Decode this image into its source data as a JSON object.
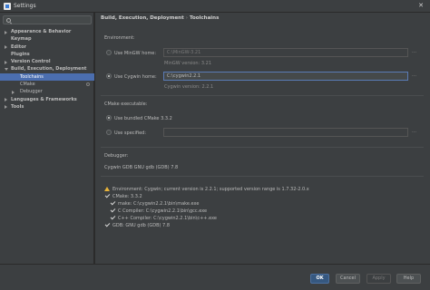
{
  "window": {
    "title": "Settings"
  },
  "search": {
    "placeholder": ""
  },
  "sidebar": {
    "items": [
      {
        "label": "Appearance & Behavior",
        "level": 0,
        "arrow": "right",
        "bold": true
      },
      {
        "label": "Keymap",
        "level": 0,
        "arrow": "none",
        "bold": true
      },
      {
        "label": "Editor",
        "level": 0,
        "arrow": "right",
        "bold": true
      },
      {
        "label": "Plugins",
        "level": 0,
        "arrow": "none",
        "bold": true
      },
      {
        "label": "Version Control",
        "level": 0,
        "arrow": "right",
        "bold": true
      },
      {
        "label": "Build, Execution, Deployment",
        "level": 0,
        "arrow": "down",
        "bold": true
      },
      {
        "label": "Toolchains",
        "level": 1,
        "arrow": "none",
        "bold": false,
        "selected": true
      },
      {
        "label": "CMake",
        "level": 1,
        "arrow": "none",
        "bold": false,
        "gear": true
      },
      {
        "label": "Debugger",
        "level": 1,
        "arrow": "right",
        "bold": false
      },
      {
        "label": "Languages & Frameworks",
        "level": 0,
        "arrow": "right",
        "bold": true
      },
      {
        "label": "Tools",
        "level": 0,
        "arrow": "right",
        "bold": true
      }
    ]
  },
  "breadcrumb": {
    "parent": "Build, Execution, Deployment",
    "separator": "›",
    "current": "Toolchains"
  },
  "environment": {
    "label": "Environment:",
    "mingw": {
      "label": "Use MinGW home:",
      "path": "C:\\MinGW-3.21",
      "version": "MinGW version: 3.21"
    },
    "cygwin": {
      "label": "Use Cygwin home:",
      "path": "C:\\cygwin2.2.1",
      "version": "Cygwin version: 2.2.1"
    }
  },
  "cmake": {
    "label": "CMake executable:",
    "bundled": "Use bundled CMake 3.3.2",
    "specified": "Use specified:",
    "specified_path": ""
  },
  "debugger": {
    "label": "Debugger:",
    "value": "Cygwin GDB GNU gdb (GDB) 7.8"
  },
  "status": {
    "warning": "Environment: Cygwin; current version is 2.2.1; supported version range is 1.7.32-2.0.x",
    "cmake": "CMake: 3.3.2",
    "make": "make: C:\\cygwin2.2.1\\bin\\make.exe",
    "c_compiler": "C Compiler: C:\\cygwin2.2.1\\bin\\gcc.exe",
    "cpp_compiler": "C++ Compiler: C:\\cygwin2.2.1\\bin\\c++.exe",
    "gdb": "GDB: GNU gdb (GDB) 7.8"
  },
  "buttons": {
    "ok": "OK",
    "cancel": "Cancel",
    "apply": "Apply",
    "help": "Help"
  },
  "colors": {
    "selection": "#4b6eaf",
    "warning": "#e8b33a",
    "primary_button": "#365880"
  }
}
